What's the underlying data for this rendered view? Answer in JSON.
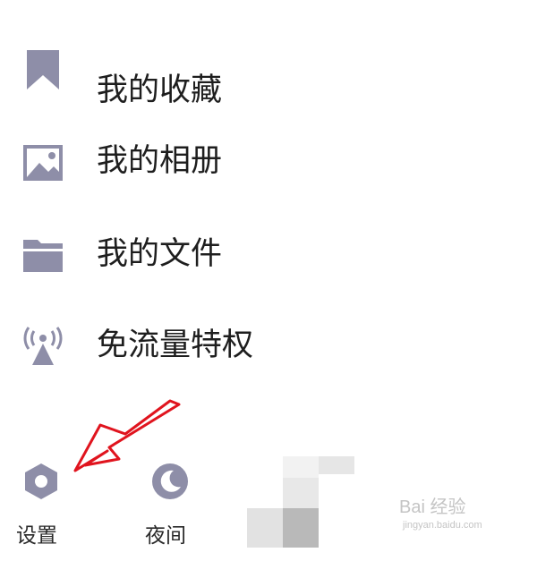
{
  "menu": {
    "items": [
      {
        "label": "我的收藏",
        "icon": "bookmark-icon"
      },
      {
        "label": "我的相册",
        "icon": "image-icon"
      },
      {
        "label": "我的文件",
        "icon": "folder-icon"
      },
      {
        "label": "免流量特权",
        "icon": "signal-tower-icon"
      }
    ]
  },
  "bottom": {
    "settings_label": "设置",
    "night_label": "夜间"
  },
  "watermark": {
    "main": "Bai 经验",
    "sub": "jingyan.baidu.com"
  },
  "colors": {
    "icon": "#8E8EA8",
    "text": "#1E1E1E",
    "annotation": "#E0141E"
  }
}
